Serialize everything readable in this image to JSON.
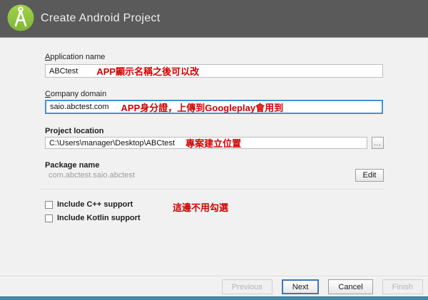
{
  "window": {
    "title": "Create Android Project"
  },
  "fields": {
    "application_name": {
      "label": "Application name",
      "value": "ABCtest",
      "annotation": "APP顯示名稱之後可以改"
    },
    "company_domain": {
      "label": "Company domain",
      "value": "saio.abctest.com",
      "annotation": "APP身分證，上傳到Googleplay會用到"
    },
    "project_location": {
      "label": "Project location",
      "value": "C:\\Users\\manager\\Desktop\\ABCtest",
      "annotation": "專案建立位置",
      "browse": "..."
    },
    "package_name": {
      "label": "Package name",
      "value": "com.abctest.saio.abctest",
      "edit": "Edit"
    }
  },
  "options": {
    "annotation": "這邊不用勾選",
    "items": [
      {
        "label": "Include C++ support",
        "checked": false
      },
      {
        "label": "Include Kotlin support",
        "checked": false
      }
    ]
  },
  "footer": {
    "previous": "Previous",
    "next": "Next",
    "cancel": "Cancel",
    "finish": "Finish"
  },
  "colors": {
    "header_bg": "#5a5a5a",
    "logo_green": "#92c83e",
    "annotation_red": "#d10000",
    "focus_border_blue": "#4193d4",
    "default_button_blue": "#3d77b8",
    "accent_bar_teal": "#4489a6"
  }
}
